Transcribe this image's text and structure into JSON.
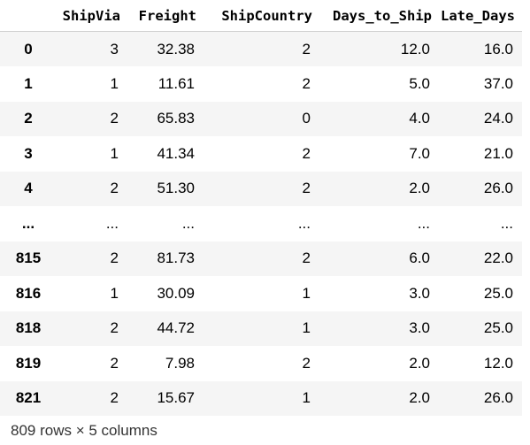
{
  "table": {
    "index_header": "",
    "columns": [
      "ShipVia",
      "Freight",
      "ShipCountry",
      "Days_to_Ship",
      "Late_Days"
    ],
    "rows": [
      {
        "index": "0",
        "cells": [
          "3",
          "32.38",
          "2",
          "12.0",
          "16.0"
        ]
      },
      {
        "index": "1",
        "cells": [
          "1",
          "11.61",
          "2",
          "5.0",
          "37.0"
        ]
      },
      {
        "index": "2",
        "cells": [
          "2",
          "65.83",
          "0",
          "4.0",
          "24.0"
        ]
      },
      {
        "index": "3",
        "cells": [
          "1",
          "41.34",
          "2",
          "7.0",
          "21.0"
        ]
      },
      {
        "index": "4",
        "cells": [
          "2",
          "51.30",
          "2",
          "2.0",
          "26.0"
        ]
      },
      {
        "index": "...",
        "cells": [
          "...",
          "...",
          "...",
          "...",
          "..."
        ]
      },
      {
        "index": "815",
        "cells": [
          "2",
          "81.73",
          "2",
          "6.0",
          "22.0"
        ]
      },
      {
        "index": "816",
        "cells": [
          "1",
          "30.09",
          "1",
          "3.0",
          "25.0"
        ]
      },
      {
        "index": "818",
        "cells": [
          "2",
          "44.72",
          "1",
          "3.0",
          "25.0"
        ]
      },
      {
        "index": "819",
        "cells": [
          "2",
          "7.98",
          "2",
          "2.0",
          "12.0"
        ]
      },
      {
        "index": "821",
        "cells": [
          "2",
          "15.67",
          "1",
          "2.0",
          "26.0"
        ]
      }
    ]
  },
  "footer": {
    "shape_text": "809 rows × 5 columns"
  }
}
